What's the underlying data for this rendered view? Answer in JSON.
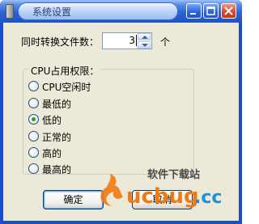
{
  "window": {
    "title": "系统设置",
    "controls": {
      "minimize_icon": "minimize-icon",
      "maximize_icon": "maximize-icon",
      "close_icon": "close-icon"
    }
  },
  "settings": {
    "convert_label": "同时转换文件数：",
    "convert_value": "3",
    "unit": "个"
  },
  "priority": {
    "legend": "CPU占用权限：",
    "options": [
      {
        "label": "CPU空闲时",
        "selected": false
      },
      {
        "label": "最低的",
        "selected": false
      },
      {
        "label": "低的",
        "selected": true
      },
      {
        "label": "正常的",
        "selected": false
      },
      {
        "label": "高的",
        "selected": false
      },
      {
        "label": "最高的",
        "selected": false
      }
    ]
  },
  "buttons": {
    "ok": "确定",
    "cancel": "取消"
  },
  "watermark": {
    "site_text": "软件下载站",
    "logo_text": "ucbug.cc"
  },
  "colors": {
    "titlebar": "#2b62d6",
    "client_bg": "#ece9d8",
    "close_button": "#d9452a",
    "selected_radio": "#2e9a2e",
    "watermark_orange": "#f07a12",
    "watermark_blue": "#1e90d8"
  }
}
